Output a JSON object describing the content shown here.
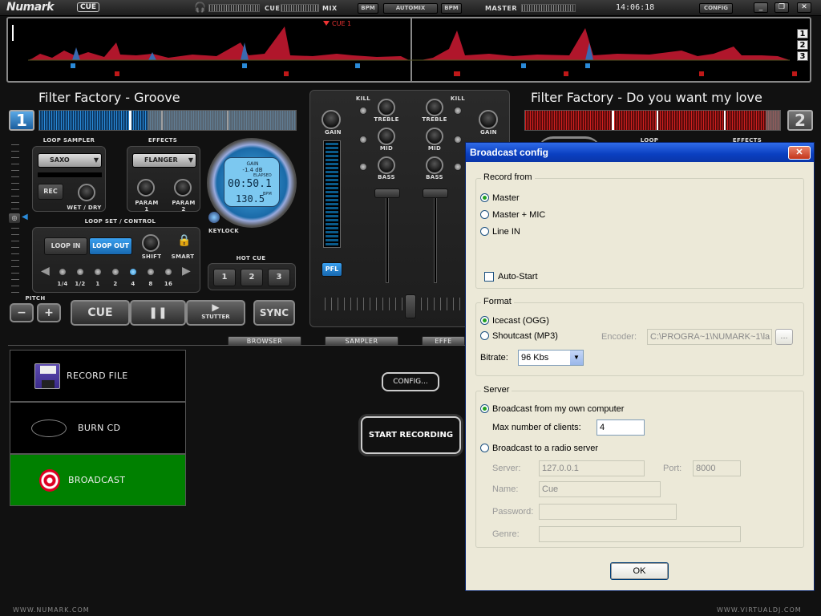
{
  "topbar": {
    "logo": "Numark",
    "badge": "CUE",
    "cue_label": "CUE",
    "mix_label": "MIX",
    "bpm1": "BPM",
    "automix": "AUTOMIX",
    "bpm2": "BPM",
    "master_label": "MASTER",
    "clock": "14:06:18",
    "config": "CONFIG"
  },
  "overview": {
    "cue_marker": "CUE 1",
    "deck_buttons": [
      "1",
      "2",
      "3"
    ]
  },
  "deck_left": {
    "title": "Filter Factory - Groove",
    "number": "1"
  },
  "deck_right": {
    "title": "Filter Factory - Do you want my love",
    "number": "2",
    "loop_sampler_label": "LOOP SAMPLER",
    "effects_label": "EFFECTS"
  },
  "loop_sampler": {
    "label": "LOOP SAMPLER",
    "selected": "SAXO",
    "rec": "REC",
    "wetdry": "WET / DRY"
  },
  "effects": {
    "label": "EFFECTS",
    "selected": "FLANGER",
    "param1": "PARAM\n1",
    "param2": "PARAM\n2"
  },
  "jog": {
    "gain": "GAIN",
    "gain_value": "-1.4 dB",
    "elapsed": "ELAPSED",
    "time": "00:50.1",
    "bpm_label": "BPM",
    "bpm": "130.5",
    "keylock": "KEYLOCK"
  },
  "loopset": {
    "label": "LOOP SET / CONTROL",
    "loop_in": "LOOP IN",
    "loop_out": "LOOP OUT",
    "shift": "SHIFT",
    "smart": "SMART",
    "sizes": [
      "1/4",
      "1/2",
      "1",
      "2",
      "4",
      "8",
      "16"
    ],
    "active_index": 4
  },
  "hotcue": {
    "label": "HOT CUE",
    "buttons": [
      "1",
      "2",
      "3"
    ]
  },
  "pitch": {
    "label": "PITCH",
    "minus": "−",
    "plus": "+"
  },
  "transport": {
    "cue": "CUE",
    "play": "❚❚",
    "stutter": "STUTTER",
    "sync": "SYNC"
  },
  "mixer": {
    "kill1": "KILL",
    "kill2": "KILL",
    "gain_l": "GAIN",
    "gain_r": "GAIN",
    "treble_l": "TREBLE",
    "treble_r": "TREBLE",
    "mid_l": "MID",
    "mid_r": "MID",
    "bass_l": "BASS",
    "bass_r": "BASS",
    "pfl": "PFL"
  },
  "tabs": {
    "browser": "BROWSER",
    "sampler": "SAMPLER",
    "effects": "EFFE"
  },
  "record_panel": {
    "items": [
      {
        "label": "RECORD FILE",
        "icon": "floppy-disk-icon"
      },
      {
        "label": "BURN CD",
        "icon": "cd-icon"
      },
      {
        "label": "BROADCAST",
        "icon": "broadcast-icon",
        "selected": true
      }
    ],
    "config_button": "CONFIG...",
    "start_button": "START RECORDING"
  },
  "footer": {
    "left": "WWW.NUMARK.COM",
    "right": "WWW.VIRTUALDJ.COM"
  },
  "dialog": {
    "title": "Broadcast config",
    "close": "✕",
    "record_from": {
      "legend": "Record from",
      "options": [
        "Master",
        "Master + MIC",
        "Line IN"
      ],
      "selected": 0,
      "autostart": "Auto-Start",
      "autostart_checked": false
    },
    "format": {
      "legend": "Format",
      "options": [
        "Icecast (OGG)",
        "Shoutcast (MP3)"
      ],
      "selected": 0,
      "encoder_label": "Encoder:",
      "encoder_value": "C:\\PROGRA~1\\NUMARK~1\\la",
      "browse": "...",
      "bitrate_label": "Bitrate:",
      "bitrate_value": "96 Kbs"
    },
    "server": {
      "legend": "Server",
      "own": "Broadcast from my own computer",
      "own_selected": true,
      "max_clients_label": "Max number of clients:",
      "max_clients": "4",
      "radio": "Broadcast to a radio server",
      "server_label": "Server:",
      "server_value": "127.0.0.1",
      "port_label": "Port:",
      "port_value": "8000",
      "name_label": "Name:",
      "name_value": "Cue",
      "password_label": "Password:",
      "password_value": "",
      "genre_label": "Genre:",
      "genre_value": ""
    },
    "ok": "OK"
  },
  "colors": {
    "deck_left": "#2a8ad8",
    "deck_right": "#d02020",
    "broadcast_selected": "#008000",
    "dialog_title": "#0a3fc0"
  }
}
